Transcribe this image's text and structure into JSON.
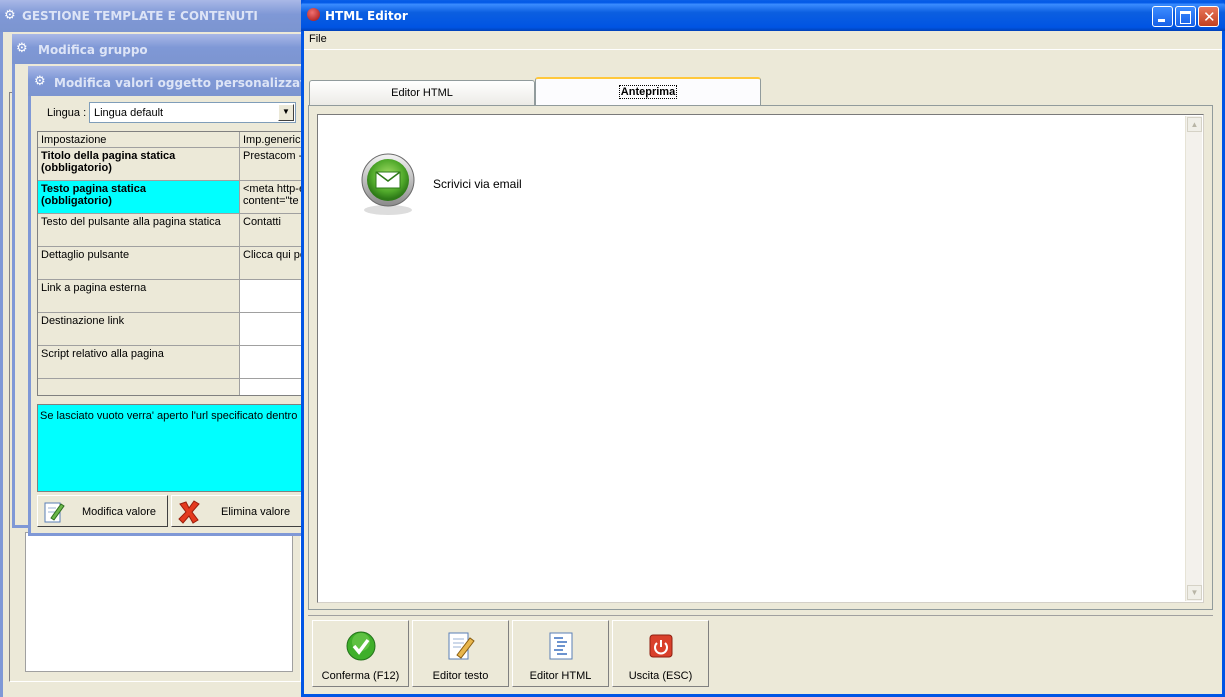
{
  "bg_window": {
    "title": "GESTIONE TEMPLATE E CONTENUTI"
  },
  "group_window": {
    "title": "Modifica gruppo"
  },
  "custom_window": {
    "title": "Modifica valori oggetto personalizzato",
    "lingua_label": "Lingua :",
    "lingua_value": "Lingua default",
    "columns": [
      "Impostazione",
      "Imp.generica"
    ],
    "rows": [
      {
        "setting": "Titolo della pagina statica\n(obbligatorio)",
        "value": "Prestacom -",
        "bold": true,
        "selected": false
      },
      {
        "setting": "Testo pagina statica\n(obbligatorio)",
        "value": "<meta http-e\ncontent=\"te",
        "bold": true,
        "selected": true
      },
      {
        "setting": "Testo del pulsante alla pagina statica",
        "value": "Contatti",
        "bold": false,
        "selected": false
      },
      {
        "setting": "Dettaglio pulsante",
        "value": "Clicca qui pe",
        "bold": false,
        "selected": false
      },
      {
        "setting": "Link a pagina esterna",
        "value": "",
        "bold": false,
        "selected": false
      },
      {
        "setting": "Destinazione link",
        "value": "",
        "bold": false,
        "selected": false
      },
      {
        "setting": "Script relativo alla pagina",
        "value": "",
        "bold": false,
        "selected": false
      }
    ],
    "description": "Se lasciato vuoto verra' aperto l'url specificato dentro",
    "edit_button": "Modifica valore",
    "delete_button": "Elimina valore"
  },
  "html_editor": {
    "title": "HTML Editor",
    "menu": [
      "File"
    ],
    "tabs": [
      {
        "label": "Editor HTML",
        "active": false
      },
      {
        "label": "Anteprima",
        "active": true
      }
    ],
    "preview": {
      "text": "Scrivici via email",
      "icon": "email-icon"
    },
    "buttons": [
      {
        "label": "Conferma (F12)",
        "icon": "check-icon"
      },
      {
        "label": "Editor testo",
        "icon": "text-edit-icon"
      },
      {
        "label": "Editor HTML",
        "icon": "html-edit-icon"
      },
      {
        "label": "Uscita (ESC)",
        "icon": "power-icon"
      }
    ]
  },
  "colors": {
    "selected_row": "#00FFFF",
    "description_bg": "#00FFFF",
    "xp_blue": "#0055E5",
    "check_green": "#3FAF2A",
    "power_red": "#D9402B"
  }
}
